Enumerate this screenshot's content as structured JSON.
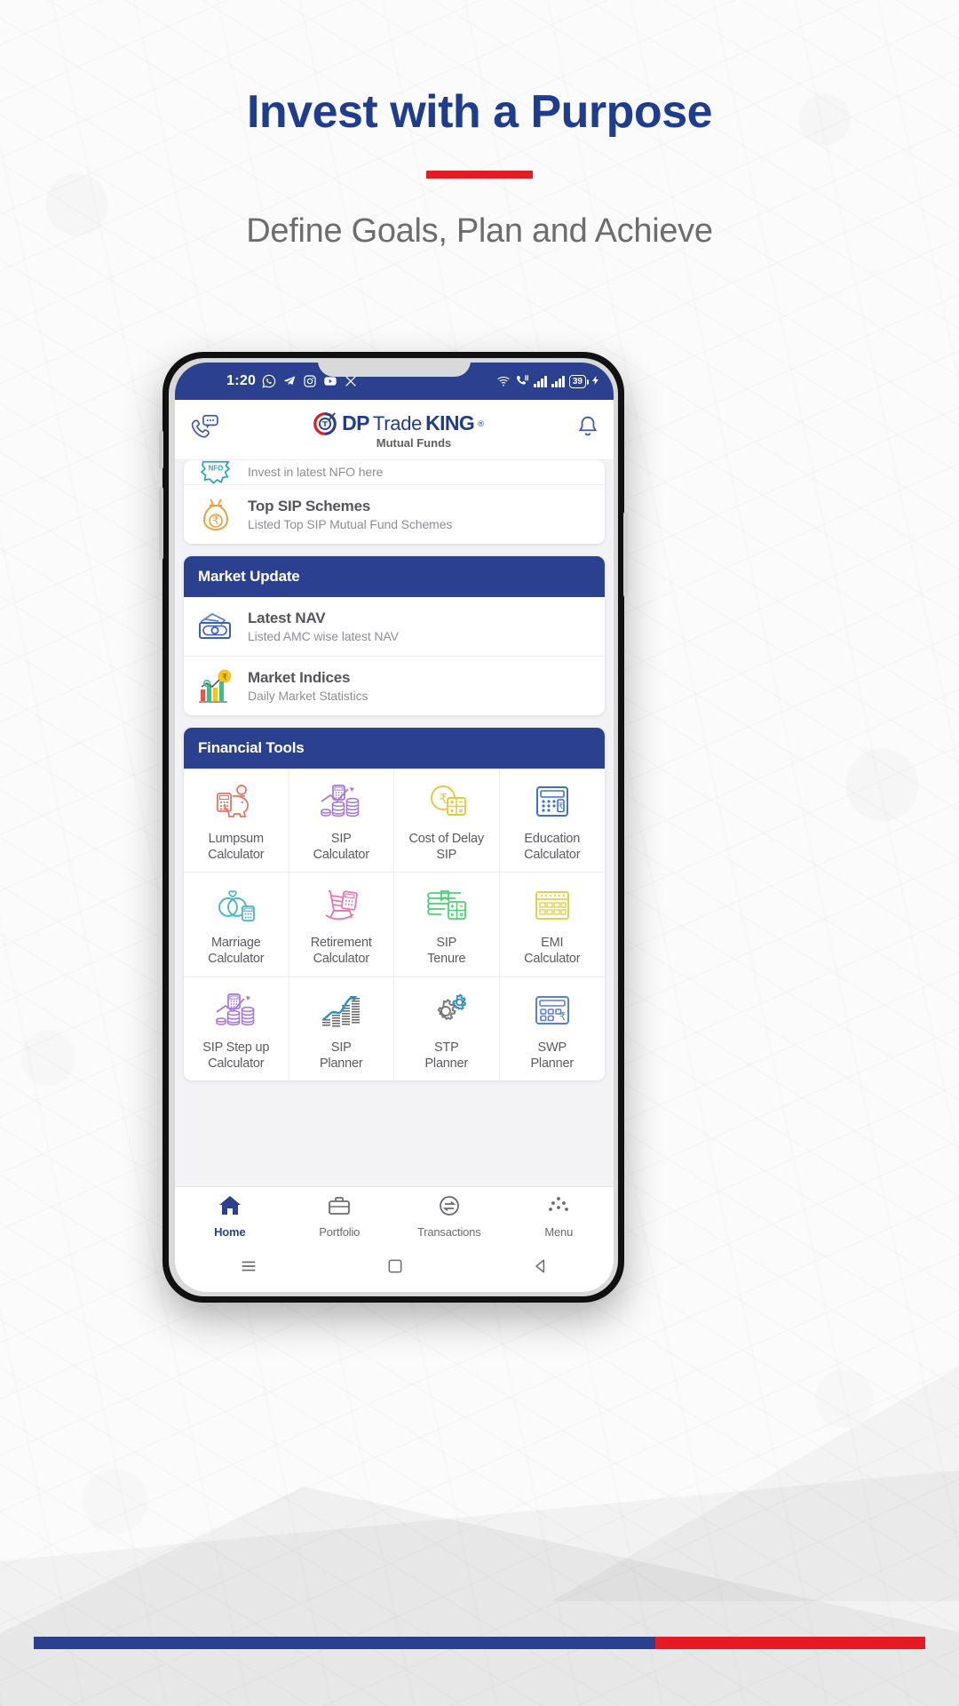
{
  "hero": {
    "title": "Invest with a Purpose",
    "subtitle": "Define Goals, Plan and Achieve",
    "accent_blue": "#1f3d8f",
    "accent_red": "#e31b23"
  },
  "phone": {
    "status_bar": {
      "time": "1:20",
      "app_icons": [
        "whatsapp-icon",
        "telegram-icon",
        "instagram-icon",
        "youtube-icon",
        "x-icon"
      ],
      "right_icons": [
        "wifi-icon",
        "missed-call-icon",
        "signal-bars-icon",
        "signal-bars-icon"
      ],
      "battery_level": "39",
      "charging": "charging-bolt-icon",
      "bg_color": "#2b418f"
    },
    "app_header": {
      "left_icon": "call-chat-icon",
      "right_icon": "bell-icon",
      "logo": {
        "mark": "dp-tradeking-logo-mark",
        "dp": "DP",
        "trade": "Trade",
        "king": "KING",
        "registered": "®",
        "tagline": "Mutual Funds"
      }
    },
    "sections": [
      {
        "id": "top-partial-card",
        "header": null,
        "rows": [
          {
            "icon": "nfo-icon",
            "title": "",
            "subtitle": "Invest in latest NFO here",
            "clipped": true
          },
          {
            "icon": "money-bag-rupee-icon",
            "title": "Top SIP Schemes",
            "subtitle": "Listed Top SIP Mutual Fund Schemes",
            "clipped": false
          }
        ]
      },
      {
        "id": "market-update",
        "header": "Market Update",
        "rows": [
          {
            "icon": "cash-note-icon",
            "title": "Latest NAV",
            "subtitle": "Listed AMC wise latest NAV",
            "clipped": false
          },
          {
            "icon": "bar-chart-rupee-icon",
            "title": "Market Indices",
            "subtitle": "Daily Market Statistics",
            "clipped": false
          }
        ]
      }
    ],
    "financial_tools": {
      "header": "Financial Tools",
      "items": [
        {
          "label_line1": "Lumpsum",
          "label_line2": "Calculator",
          "icon": "piggy-bank-calculator-icon",
          "color": "#e8735f"
        },
        {
          "label_line1": "SIP",
          "label_line2": "Calculator",
          "icon": "coins-calculator-icon",
          "color": "#a474e0"
        },
        {
          "label_line1": "Cost of Delay",
          "label_line2": "SIP",
          "icon": "rupee-coin-calculator-icon",
          "color": "#e8c73a"
        },
        {
          "label_line1": "Education",
          "label_line2": "Calculator",
          "icon": "education-calculator-icon",
          "color": "#3b6fd4"
        },
        {
          "label_line1": "Marriage",
          "label_line2": "Calculator",
          "icon": "wedding-rings-calculator-icon",
          "color": "#4ab5c8"
        },
        {
          "label_line1": "Retirement",
          "label_line2": "Calculator",
          "icon": "rocking-chair-calculator-icon",
          "color": "#e878b0"
        },
        {
          "label_line1": "SIP",
          "label_line2": "Tenure",
          "icon": "book-calculator-icon",
          "color": "#4fcf72"
        },
        {
          "label_line1": "EMI",
          "label_line2": "Calculator",
          "icon": "emi-calendar-calculator-icon",
          "color": "#e3d04a"
        },
        {
          "label_line1": "SIP Step up",
          "label_line2": "Calculator",
          "icon": "stepup-coins-calculator-icon",
          "color": "#a474e0"
        },
        {
          "label_line1": "SIP",
          "label_line2": "Planner",
          "icon": "growth-chart-arrow-icon",
          "color": "#2b8fc4"
        },
        {
          "label_line1": "STP",
          "label_line2": "Planner",
          "icon": "gears-icon",
          "color": "#7a7a7a"
        },
        {
          "label_line1": "SWP",
          "label_line2": "Planner",
          "icon": "calculator-rupee-icon",
          "color": "#5a7fd4"
        }
      ]
    },
    "bottom_nav": [
      {
        "label": "Home",
        "icon": "home-icon",
        "active": true
      },
      {
        "label": "Portfolio",
        "icon": "briefcase-icon",
        "active": false
      },
      {
        "label": "Transactions",
        "icon": "exchange-icon",
        "active": false
      },
      {
        "label": "Menu",
        "icon": "dots-menu-icon",
        "active": false
      }
    ],
    "android_nav": [
      "recents-icon",
      "home-square-icon",
      "back-triangle-icon"
    ]
  },
  "footer_bar": {
    "blue": "#2b418f",
    "red": "#e31b23"
  }
}
